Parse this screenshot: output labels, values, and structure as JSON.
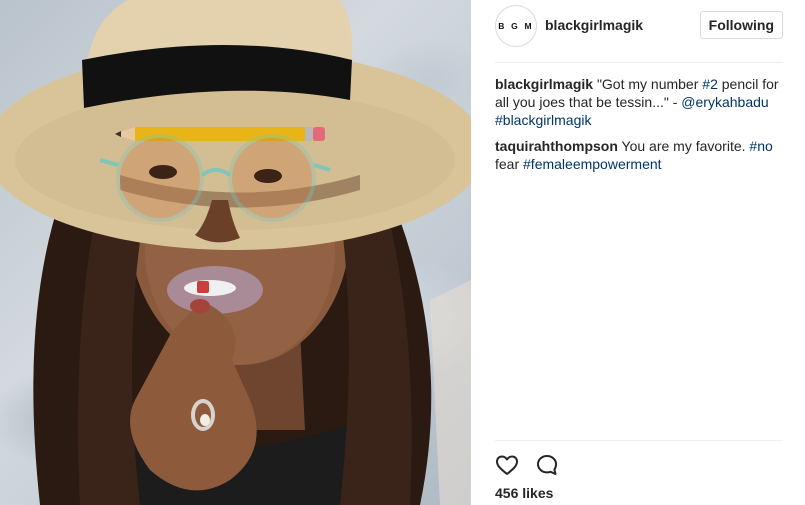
{
  "post": {
    "image_alt": "Photo posted by blackgirlmagik"
  },
  "header": {
    "avatar_text": "B G M",
    "username": "blackgirlmagik",
    "follow_label": "Following"
  },
  "caption": {
    "author": "blackgirlmagik",
    "text_1": "\"Got my number ",
    "hashtag_1": "#2",
    "text_2": " pencil for all you joes that be tessin...\" - ",
    "mention": "@erykahbadu",
    "text_3": " ",
    "hashtag_2": "#blackgirlmagik"
  },
  "comment": {
    "author": "taquirahthompson",
    "text_1": " You are my favorite. ",
    "hashtag_1": "#no",
    "text_2": " fear ",
    "hashtag_2": "#femaleempowerment"
  },
  "actions": {
    "like_icon": "heart-icon",
    "comment_icon": "comment-bubble-icon"
  },
  "likes": {
    "label": "456 likes"
  },
  "colors": {
    "link": "#003569",
    "text": "#262626",
    "border": "#dbdbdb"
  }
}
